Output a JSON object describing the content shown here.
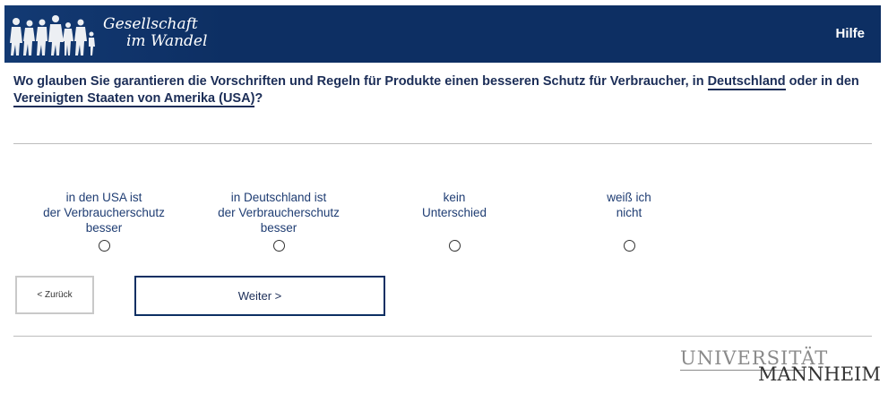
{
  "header": {
    "logo_line1": "Gesellschaft",
    "logo_line2": "im Wandel",
    "help_label": "Hilfe",
    "background": "#0d2f63"
  },
  "question": {
    "text_1": "Wo glauben Sie garantieren die Vorschriften und Regeln für Produkte einen besseren Schutz für Verbraucher, in ",
    "term_1": "Deutschland",
    "text_2": " oder in den ",
    "term_2": "Vereinigten Staaten von Amerika (USA)",
    "text_3": "?"
  },
  "options": [
    {
      "line1": "in den USA ist",
      "line2": "der Verbraucherschutz",
      "line3": "besser",
      "selected": false
    },
    {
      "line1": "in Deutschland ist",
      "line2": "der Verbraucherschutz",
      "line3": "besser",
      "selected": false
    },
    {
      "line1": "kein",
      "line2": "Unterschied",
      "line3": "",
      "selected": false
    },
    {
      "line1": "weiß ich",
      "line2": "nicht",
      "line3": "",
      "selected": false
    }
  ],
  "navigation": {
    "back_label": "< Zurück",
    "next_label": "Weiter >"
  },
  "footer": {
    "university_line1": "UNIVERSITÄT",
    "university_line2": "MANNHEIM"
  }
}
